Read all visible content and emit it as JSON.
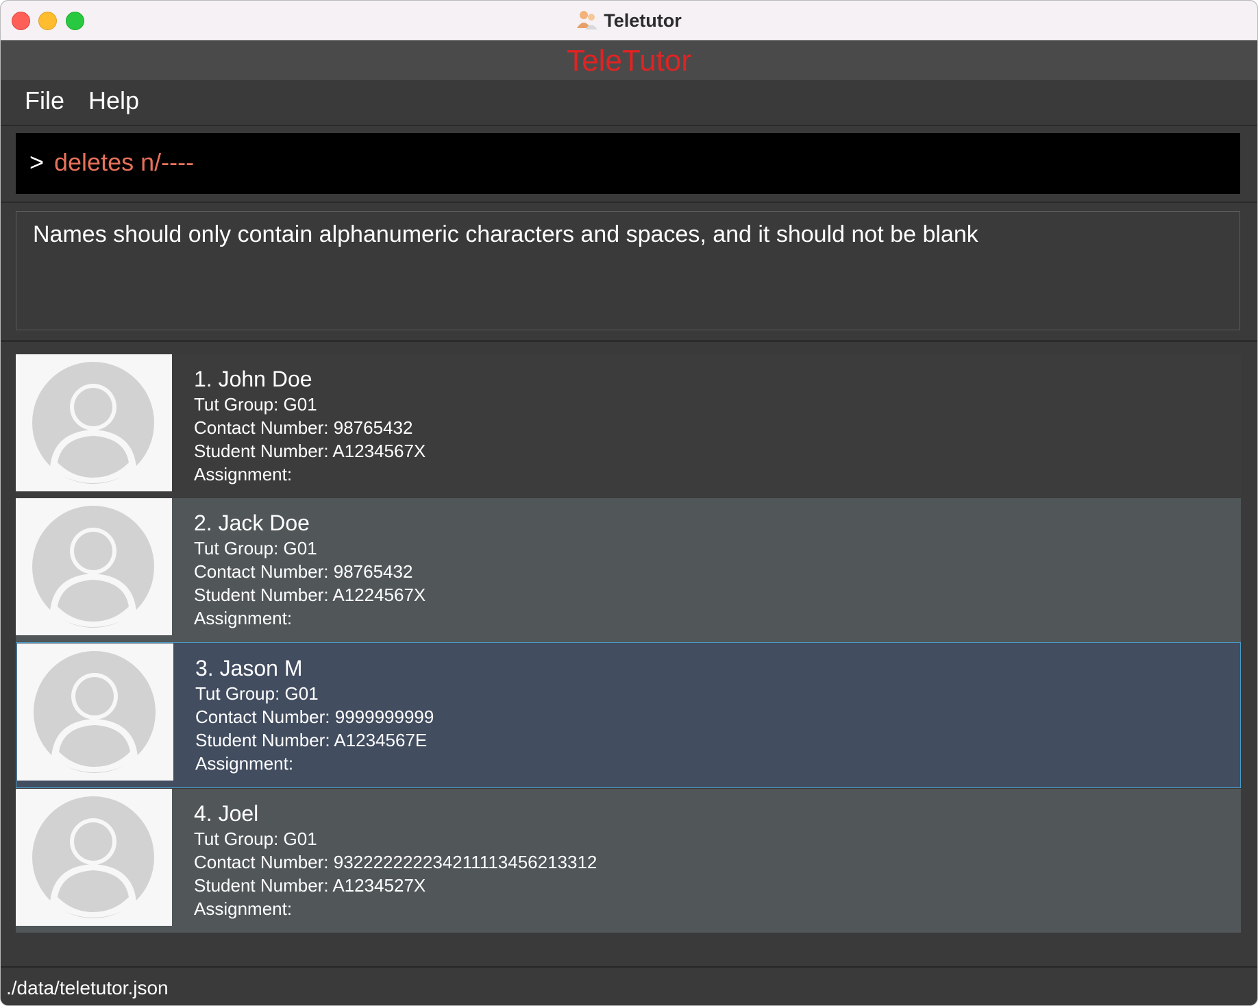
{
  "window": {
    "title": "Teletutor",
    "icon": "people-app-icon"
  },
  "banner": {
    "title": "TeleTutor",
    "color": "#e02323"
  },
  "menu": {
    "items": [
      {
        "label": "File"
      },
      {
        "label": "Help"
      }
    ]
  },
  "command_box": {
    "prompt": ">",
    "value": "deletes n/----",
    "text_color": "#e8715b"
  },
  "result_display": {
    "message": "Names should only contain alphanumeric characters and spaces, and it should not be blank"
  },
  "students": [
    {
      "name": "1. John Doe",
      "tut_group": "Tut Group: G01",
      "contact": "Contact Number: 98765432",
      "student_number": "Student Number: A1234567X",
      "assignment": "Assignment:",
      "selected": false
    },
    {
      "name": "2. Jack Doe",
      "tut_group": "Tut Group: G01",
      "contact": "Contact Number: 98765432",
      "student_number": "Student Number: A1224567X",
      "assignment": "Assignment:",
      "selected": false
    },
    {
      "name": "3. Jason M",
      "tut_group": "Tut Group: G01",
      "contact": "Contact Number: 9999999999",
      "student_number": "Student Number: A1234567E",
      "assignment": "Assignment:",
      "selected": true
    },
    {
      "name": "4. Joel",
      "tut_group": "Tut Group: G01",
      "contact": "Contact Number: 932222222234211113456213312",
      "student_number": "Student Number: A1234527X",
      "assignment": "Assignment:",
      "selected": false
    }
  ],
  "status_bar": {
    "path": "./data/teletutor.json"
  },
  "colors": {
    "selected_card": "#424d60",
    "selected_border": "#4a9cc7"
  }
}
